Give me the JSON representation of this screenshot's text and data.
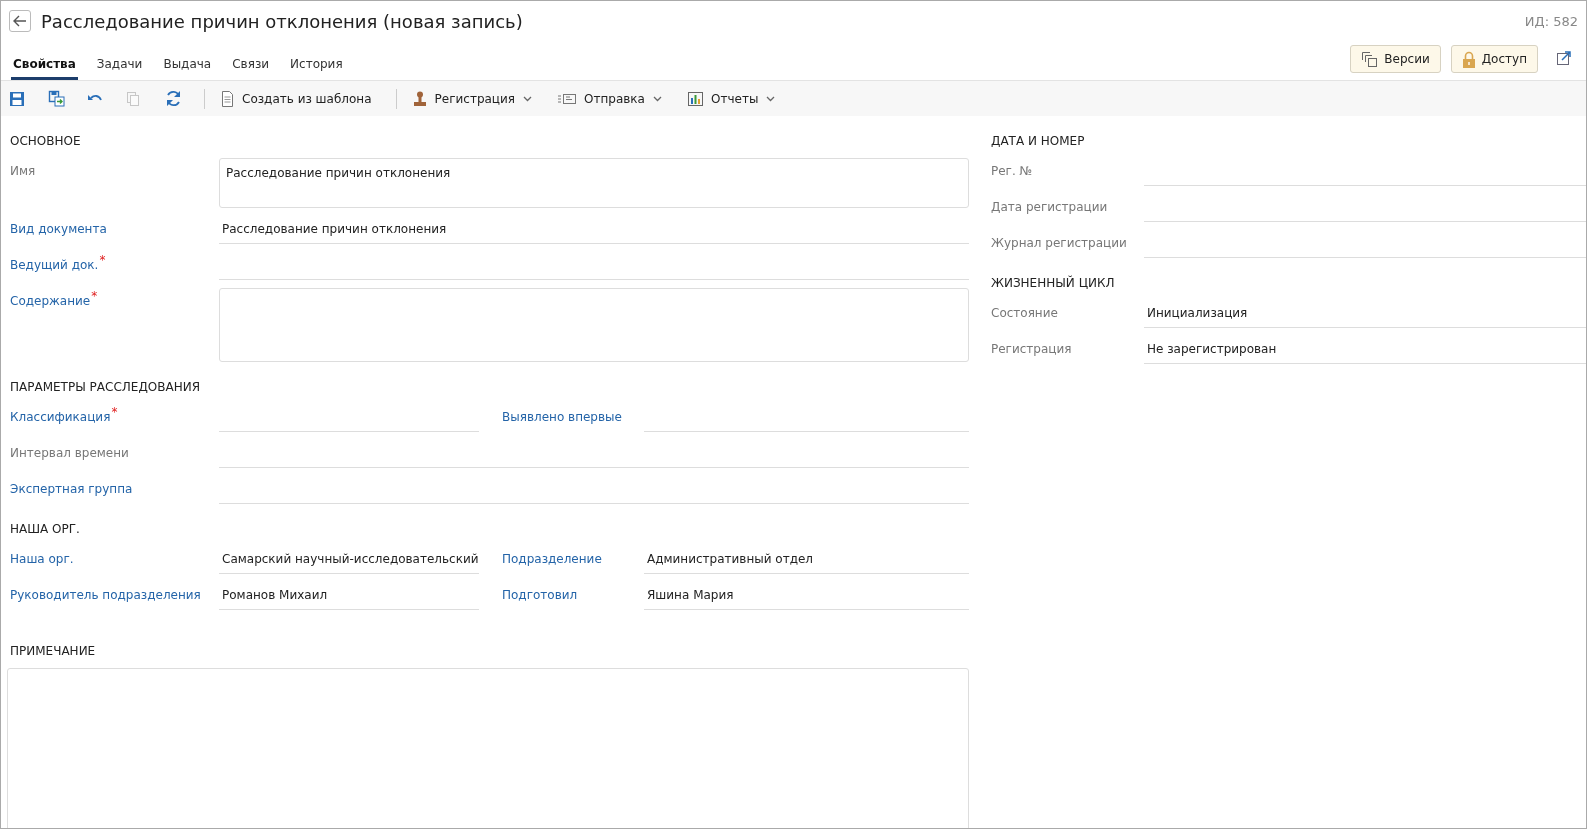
{
  "window": {
    "title": "Расследование причин отклонения (новая запись)",
    "id_label": "ИД: 582"
  },
  "tabs": [
    {
      "label": "Свойства",
      "selected": true
    },
    {
      "label": "Задачи",
      "selected": false
    },
    {
      "label": "Выдача",
      "selected": false
    },
    {
      "label": "Связи",
      "selected": false
    },
    {
      "label": "История",
      "selected": false
    }
  ],
  "header_buttons": [
    {
      "label": "Версии"
    },
    {
      "label": "Доступ"
    }
  ],
  "toolbar": {
    "icon_buttons": [
      {
        "disabled": false
      },
      {
        "disabled": false
      },
      {
        "disabled": false
      },
      {
        "disabled": true
      },
      {
        "disabled": false
      }
    ],
    "buttons": [
      {
        "label": "Создать из шаблона",
        "dropdown": false
      },
      {
        "label": "Регистрация",
        "dropdown": true
      },
      {
        "label": "Отправка",
        "dropdown": true
      },
      {
        "label": "Отчеты",
        "dropdown": true
      }
    ]
  },
  "left_sections": [
    {
      "title": "ОСНОВНОЕ",
      "rows": [
        {
          "fields": [
            {
              "label": "Имя",
              "link": false,
              "kind": "area",
              "value": "Расследование причин отклонения"
            }
          ]
        },
        {
          "fields": [
            {
              "label": "Вид документа",
              "link": true,
              "kind": "line",
              "value": "Расследование причин отклонения"
            }
          ]
        },
        {
          "fields": [
            {
              "label": "Ведущий док.",
              "link": true,
              "required_mark": "*",
              "kind": "line"
            }
          ]
        },
        {
          "fields": [
            {
              "label": "Содержание",
              "link": true,
              "required_mark": "*",
              "kind": "bigarea"
            }
          ]
        }
      ]
    },
    {
      "title": "ПАРАМЕТРЫ РАССЛЕДОВАНИЯ",
      "rows": [
        {
          "fields": [
            {
              "label": "Классификация",
              "link": true,
              "required_mark": "*",
              "kind": "line"
            },
            {
              "label": "Выявлено впервые",
              "link": true,
              "kind": "line"
            }
          ]
        },
        {
          "fields": [
            {
              "label": "Интервал времени",
              "link": false,
              "kind": "line"
            }
          ]
        },
        {
          "fields": [
            {
              "label": "Экспертная группа",
              "link": true,
              "kind": "wide"
            }
          ]
        }
      ]
    },
    {
      "title": "НАША ОРГ.",
      "rows": [
        {
          "fields": [
            {
              "label": "Наша орг.",
              "link": true,
              "kind": "line",
              "value": "Самарский научный-исследовательский"
            },
            {
              "label": "Подразделение",
              "link": true,
              "kind": "line",
              "value": "Административный отдел"
            }
          ]
        },
        {
          "fields": [
            {
              "label": "Руководитель подразделения",
              "link": true,
              "kind": "line",
              "value": "Романов Михаил"
            },
            {
              "label": "Подготовил",
              "link": true,
              "kind": "line",
              "value": "Яшина Мария"
            }
          ]
        }
      ]
    }
  ],
  "note": {
    "title": "ПРИМЕЧАНИЕ"
  },
  "right_sections": [
    {
      "title": "ДАТА И НОМЕР",
      "rows": [
        {
          "fields": [
            {
              "label": "Рег. №",
              "link": false,
              "kind": "line"
            }
          ]
        },
        {
          "fields": [
            {
              "label": "Дата регистрации",
              "link": false,
              "kind": "line"
            }
          ]
        },
        {
          "fields": [
            {
              "label": "Журнал регистрации",
              "link": false,
              "kind": "line"
            }
          ]
        }
      ]
    },
    {
      "title": "ЖИЗНЕННЫЙ ЦИКЛ",
      "rows": [
        {
          "fields": [
            {
              "label": "Состояние",
              "link": false,
              "kind": "line",
              "value": "Инициализация"
            }
          ]
        },
        {
          "fields": [
            {
              "label": "Регистрация",
              "link": false,
              "kind": "line",
              "value": "Не зарегистрирован"
            }
          ]
        }
      ]
    }
  ]
}
